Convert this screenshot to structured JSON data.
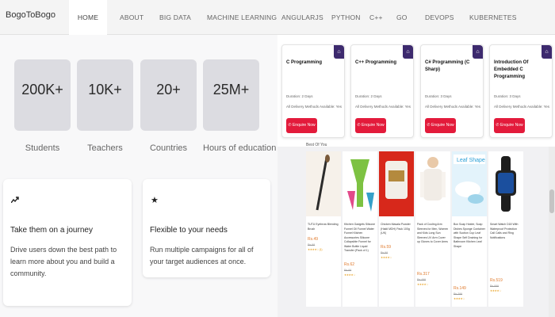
{
  "brand": "BogoToBogo",
  "nav": {
    "items": [
      {
        "label": "HOME",
        "active": true
      },
      {
        "label": "ABOUT",
        "active": false
      },
      {
        "label": "BIG DATA",
        "active": false
      },
      {
        "label": "MACHINE LEARNING",
        "active": false
      },
      {
        "label": "ANGULARJS",
        "active": false
      },
      {
        "label": "PYTHON",
        "active": false
      },
      {
        "label": "C++",
        "active": false
      },
      {
        "label": "GO",
        "active": false
      },
      {
        "label": "DEVOPS",
        "active": false
      },
      {
        "label": "KUBERNETES",
        "active": false
      }
    ]
  },
  "stats": [
    {
      "value": "200K+",
      "label": "Students"
    },
    {
      "value": "10K+",
      "label": "Teachers"
    },
    {
      "value": "20+",
      "label": "Countries"
    },
    {
      "value": "25M+",
      "label": "Hours of education"
    }
  ],
  "features": [
    {
      "icon": "trend-icon",
      "title": "Take them on a journey",
      "description": "Drive users down the best path to learn more about you and build a community."
    },
    {
      "icon": "star-icon",
      "title": "Flexible to your needs",
      "description": "Run multiple campaigns for all of your target audiences at once."
    }
  ],
  "courses": [
    {
      "title": "C Programming",
      "duration": "Duration: 2 Days",
      "delivery": "All Delivery Methods Available: Yes",
      "button": "Enquire Now"
    },
    {
      "title": "C++ Programming",
      "duration": "Duration: 2 Days",
      "delivery": "All Delivery Methods Available: Yes",
      "button": "Enquire Now"
    },
    {
      "title": "C# Programming (C Sharp)",
      "duration": "Duration: 3 Days",
      "delivery": "All Delivery Methods Available: Yes",
      "button": "Enquire Now"
    },
    {
      "title": "Introduction Of Embedded C Programming",
      "duration": "Duration: 3 Days",
      "delivery": "All Delivery Methods Available: Yes",
      "button": "Enquire Now"
    }
  ],
  "products": [
    {
      "name": "TUTU Eyebrow Blending Brush",
      "price": "Rs.49",
      "mrp": "Rs.99",
      "rating": "★★★★☆ (1)"
    },
    {
      "name": "Kitchen Gadgets Silicone Funnel Oil Funnel Water Funnel Kitchen Accessories Silicone Collapsible Funnel for Water Bottle Liquid Transfer (Pack of 1)",
      "price": "Rs.62",
      "mrp": "Rs.99",
      "rating": "★★★★☆"
    },
    {
      "name": "Chicken Masala Powder (Haldi MDH) Pack 100g (UK)",
      "price": "Rs.59",
      "mrp": "Rs.99",
      "rating": "★★★★☆"
    },
    {
      "name": "Pack of Cooling Arm Sleeves for Men, Women and Kids Long Sun Sleeves UV Arm Cover up Gloves to Cover Arms",
      "price": "Rs.317",
      "mrp": "Rs.499",
      "rating": "★★★★☆"
    },
    {
      "name": "Box Soap Holder, Soap Dishes Sponge Container with Suction Cup Leaf Shape Self Draining for Bathroom Kitchen Leaf Shape",
      "price": "Rs.149",
      "mrp": "Rs.299",
      "rating": "★★★★☆"
    },
    {
      "name": "Smart Watch D18 With Waterproof Protection Call Calls and Ring Notifications",
      "price": "Rs.519",
      "mrp": "Rs.999",
      "rating": "★★★★☆"
    }
  ],
  "section_label": "Best Of You",
  "colors": {
    "accent": "#e31b3b",
    "badge": "#3d2a6e",
    "stat_bg": "#dcdce1"
  }
}
